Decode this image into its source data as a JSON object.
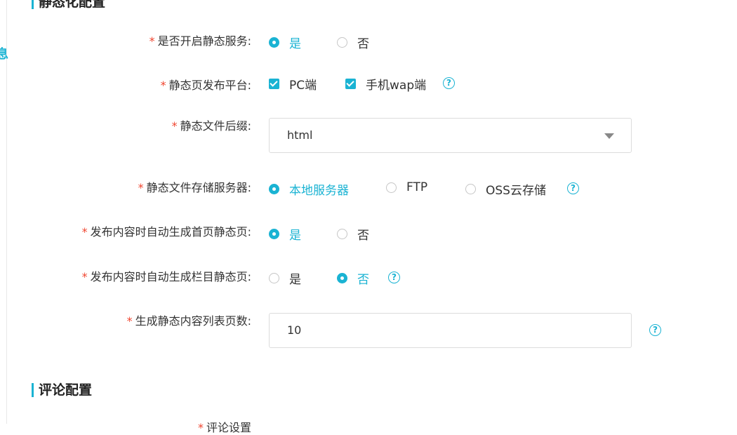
{
  "sections": {
    "static": "静态化配置",
    "comment": "评论配置"
  },
  "fields": {
    "enable_static": {
      "label": "是否开启静态服务:",
      "options": [
        "是",
        "否"
      ],
      "selected": 0
    },
    "platform": {
      "label": "静态页发布平台:",
      "options": [
        "PC端",
        "手机wap端"
      ],
      "checked": [
        true,
        true
      ]
    },
    "suffix": {
      "label": "静态文件后缀:",
      "value": "html"
    },
    "storage": {
      "label": "静态文件存储服务器:",
      "options": [
        "本地服务器",
        "FTP",
        "OSS云存储"
      ],
      "selected": 0
    },
    "auto_home": {
      "label": "发布内容时自动生成首页静态页:",
      "options": [
        "是",
        "否"
      ],
      "selected": 0
    },
    "auto_column": {
      "label": "发布内容时自动生成栏目静态页:",
      "options": [
        "是",
        "否"
      ],
      "selected": 1
    },
    "list_pages": {
      "label": "生成静态内容列表页数:",
      "value": "10"
    }
  },
  "comment_next": {
    "label": "评论设置"
  },
  "colors": {
    "accent": "#1ab3d3",
    "required": "#f0442e"
  },
  "icons": {
    "help": "question-circle-icon",
    "dropdown": "caret-down-icon"
  }
}
